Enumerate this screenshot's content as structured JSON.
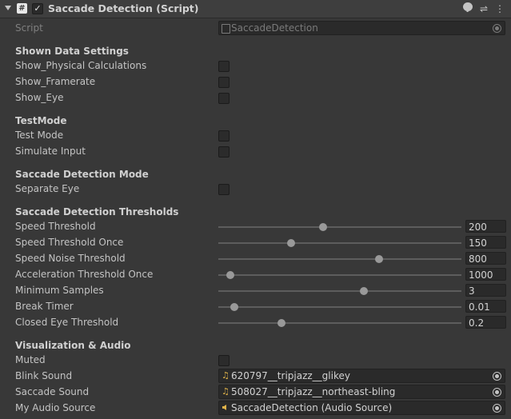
{
  "header": {
    "title": "Saccade Detection (Script)",
    "enabled": true
  },
  "script_field": {
    "label": "Script",
    "value": "SaccadeDetection"
  },
  "sections": {
    "shown_data": "Shown Data Settings",
    "test_mode": "TestMode",
    "detection_mode": "Saccade Detection Mode",
    "thresholds": "Saccade Detection Thresholds",
    "visualization": "Visualization & Audio"
  },
  "toggles": {
    "show_physical": {
      "label": "Show_Physical Calculations",
      "checked": false
    },
    "show_framerate": {
      "label": "Show_Framerate",
      "checked": false
    },
    "show_eye": {
      "label": "Show_Eye",
      "checked": false
    },
    "test_mode": {
      "label": "Test Mode",
      "checked": false
    },
    "simulate_input": {
      "label": "Simulate Input",
      "checked": false
    },
    "separate_eye": {
      "label": "Separate Eye",
      "checked": false
    },
    "muted": {
      "label": "Muted",
      "checked": false
    }
  },
  "sliders": [
    {
      "label": "Speed Threshold",
      "value": "200",
      "fraction": 0.43
    },
    {
      "label": "Speed Threshold Once",
      "value": "150",
      "fraction": 0.3
    },
    {
      "label": "Speed Noise Threshold",
      "value": "800",
      "fraction": 0.66
    },
    {
      "label": "Acceleration Threshold Once",
      "value": "1000",
      "fraction": 0.05
    },
    {
      "label": "Minimum Samples",
      "value": "3",
      "fraction": 0.6
    },
    {
      "label": "Break Timer",
      "value": "0.01",
      "fraction": 0.065
    },
    {
      "label": "Closed Eye Threshold",
      "value": "0.2",
      "fraction": 0.26
    }
  ],
  "object_fields": {
    "blink_sound": {
      "label": "Blink Sound",
      "value": "620797__tripjazz__glikey",
      "icon": "audio-clip-icon"
    },
    "saccade_sound": {
      "label": "Saccade Sound",
      "value": "508027__tripjazz__northeast-bling",
      "icon": "audio-clip-icon"
    },
    "audio_source": {
      "label": "My Audio Source",
      "value": "SaccadeDetection (Audio Source)",
      "icon": "audio-source-icon"
    }
  },
  "colors": {
    "background": "#383838",
    "field": "#2a2a2a",
    "text": "#c4c4c4",
    "audio_icon": "#e0b34a"
  }
}
